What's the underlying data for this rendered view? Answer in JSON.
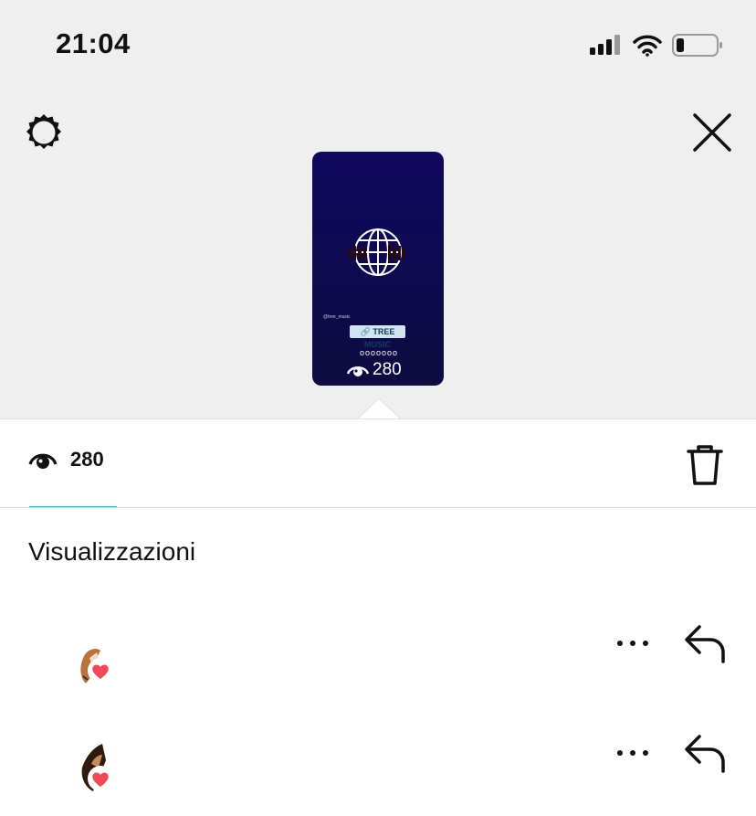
{
  "status_bar": {
    "time": "21:04"
  },
  "story_preview": {
    "handle": "@tree_music",
    "link_sticker": "TREE MUSIC",
    "dots": "ooooooo",
    "view_count": "280"
  },
  "stats": {
    "view_count": "280"
  },
  "section": {
    "title": "Visualizzazioni"
  },
  "viewers": [
    {
      "name": ""
    },
    {
      "name": ""
    }
  ],
  "colors": {
    "story_bg": "#10075e",
    "heart": "#ed4956",
    "tab_accent": "#4b98c2"
  }
}
